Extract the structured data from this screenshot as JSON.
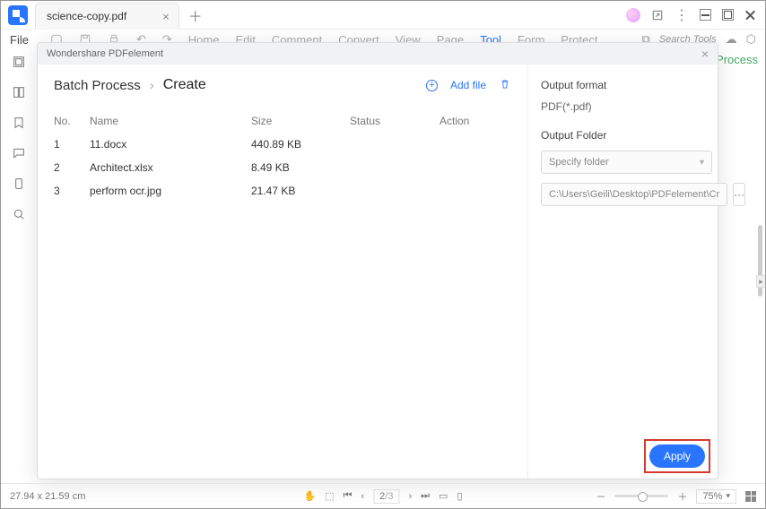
{
  "titlebar": {
    "tab_title": "science-copy.pdf"
  },
  "menu": {
    "file": "File",
    "items": [
      "Home",
      "Edit",
      "Comment",
      "Convert",
      "View",
      "Page",
      "Tool",
      "Form",
      "Protect"
    ],
    "search_placeholder": "Search Tools"
  },
  "right_peek": "Process",
  "modal": {
    "title": "Wondershare PDFelement",
    "breadcrumb_root": "Batch Process",
    "breadcrumb_current": "Create",
    "add_file": "Add file",
    "columns": {
      "no": "No.",
      "name": "Name",
      "size": "Size",
      "status": "Status",
      "action": "Action"
    },
    "rows": [
      {
        "no": "1",
        "name": "11.docx",
        "size": "440.89 KB"
      },
      {
        "no": "2",
        "name": "Architect.xlsx",
        "size": "8.49 KB"
      },
      {
        "no": "3",
        "name": "perform ocr.jpg",
        "size": "21.47 KB"
      }
    ],
    "out_format_label": "Output format",
    "out_format_value": "PDF(*.pdf)",
    "out_folder_label": "Output Folder",
    "folder_mode": "Specify folder",
    "folder_path": "C:\\Users\\Geili\\Desktop\\PDFelement\\Cr",
    "apply": "Apply"
  },
  "status": {
    "dims": "27.94 x 21.59 cm",
    "page": "2",
    "pages": "/3",
    "zoom": "75%"
  }
}
